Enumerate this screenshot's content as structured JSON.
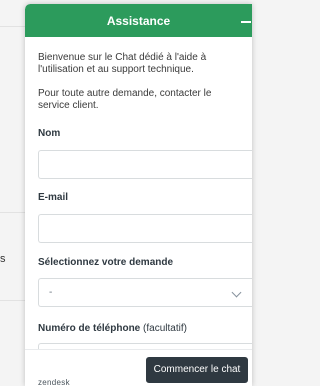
{
  "background": {
    "glyph": "s"
  },
  "widget": {
    "header": {
      "title": "Assistance",
      "minimize_icon": "minimize-icon"
    },
    "intro": {
      "line1": "Bienvenue sur le Chat dédié à l'aide à l'utilisation et au support technique.",
      "line2": "Pour toute autre demande, contacter le service client."
    },
    "form": {
      "name_label": "Nom",
      "name_value": "",
      "email_label": "E-mail",
      "email_value": "",
      "request_label": "Sélectionnez votre demande",
      "request_value": "-",
      "phone_label": "Numéro de téléphone",
      "phone_optional": "(facultatif)"
    },
    "footer": {
      "brand": "zendesk",
      "start_button": "Commencer le chat"
    }
  },
  "colors": {
    "header": "#2c9b5c",
    "button": "#2f3941"
  }
}
